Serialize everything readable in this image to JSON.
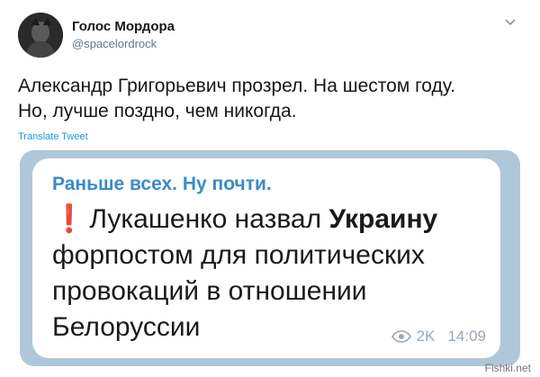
{
  "tweet": {
    "display_name": "Голос Мордора",
    "handle": "@spacelordrock",
    "text_line1": "Александр Григорьевич прозрел. На шестом году.",
    "text_line2": "Но, лучше поздно, чем никогда.",
    "translate_label": "Translate Tweet",
    "menu_icon": "chevron-down-icon"
  },
  "embed": {
    "channel_title": "Раньше всех. Ну почти.",
    "headline": {
      "marker": "❗",
      "line1_start": "Лукашенко назвал ",
      "line1_bold": "Украину",
      "line2": "форпостом для политических",
      "line3": "провокаций в отношении",
      "line4": "Белоруссии"
    },
    "views": "2K",
    "time": "14:09",
    "views_icon": "eye-icon"
  },
  "watermark": "Fishki.net",
  "colors": {
    "channel_title": "#3a8bc6",
    "translate_link": "#1b95e0",
    "frame": "#afc8d9",
    "marker": "#e5302b"
  }
}
